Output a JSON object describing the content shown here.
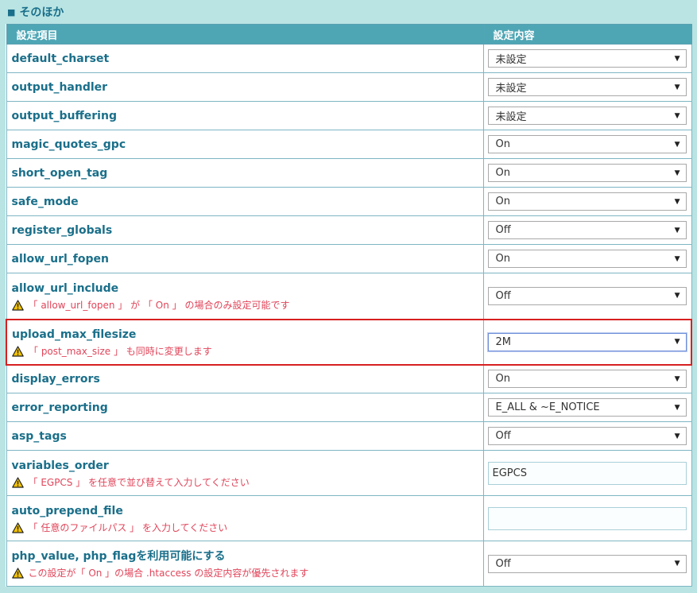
{
  "section": {
    "title": "そのほか"
  },
  "table": {
    "headers": {
      "item": "設定項目",
      "value": "設定内容"
    },
    "rows": [
      {
        "name": "default_charset",
        "value": "未設定"
      },
      {
        "name": "output_handler",
        "value": "未設定"
      },
      {
        "name": "output_buffering",
        "value": "未設定"
      },
      {
        "name": "magic_quotes_gpc",
        "value": "On"
      },
      {
        "name": "short_open_tag",
        "value": "On"
      },
      {
        "name": "safe_mode",
        "value": "On"
      },
      {
        "name": "register_globals",
        "value": "Off"
      },
      {
        "name": "allow_url_fopen",
        "value": "On"
      },
      {
        "name": "allow_url_include",
        "value": "Off",
        "note": "「 allow_url_fopen 」 が 「 On 」 の場合のみ設定可能です"
      },
      {
        "name": "upload_max_filesize",
        "value": "2M",
        "note": "「 post_max_size 」 も同時に変更します",
        "highlighted": true
      },
      {
        "name": "display_errors",
        "value": "On"
      },
      {
        "name": "error_reporting",
        "value": "E_ALL & ~E_NOTICE"
      },
      {
        "name": "asp_tags",
        "value": "Off"
      },
      {
        "name": "variables_order",
        "value": "EGPCS",
        "note": "「 EGPCS 」 を任意で並び替えて入力してください"
      },
      {
        "name": "auto_prepend_file",
        "value": "",
        "note": "「 任意のファイルパス 」 を入力してください"
      },
      {
        "name": "php_value, php_flagを利用可能にする",
        "value": "Off",
        "note": "この設定が「 On 」の場合 .htaccess の設定内容が優先されます"
      }
    ]
  },
  "colors": {
    "highlight": "#d82020",
    "note_text": "#e0455a",
    "header_bg": "#4ea6b5",
    "page_bg": "#b9e4e3"
  },
  "icons": {
    "warning": "warning-icon",
    "dropdown": "chevron-down-icon",
    "bullet": "square-bullet-icon"
  }
}
